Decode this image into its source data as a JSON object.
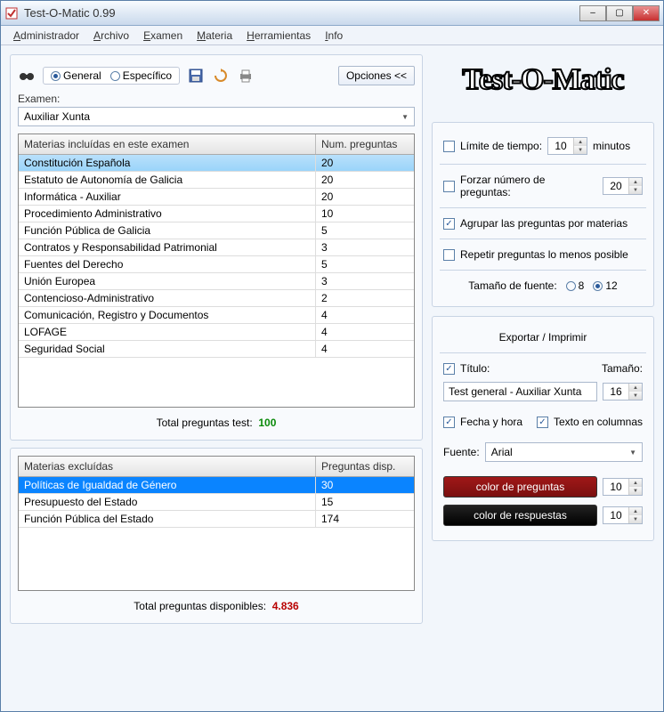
{
  "window": {
    "title": "Test-O-Matic 0.99"
  },
  "menu": [
    "Administrador",
    "Archivo",
    "Examen",
    "Materia",
    "Herramientas",
    "Info"
  ],
  "toolbar": {
    "general": "General",
    "especifico": "Específico",
    "opciones": "Opciones  <<"
  },
  "examen": {
    "label": "Examen:",
    "value": "Auxiliar Xunta"
  },
  "included": {
    "col1": "Materias incluídas en este examen",
    "col2": "Num. preguntas",
    "rows": [
      {
        "name": "Constitución Española",
        "n": "20"
      },
      {
        "name": "Estatuto de Autonomía de Galicia",
        "n": "20"
      },
      {
        "name": "Informática - Auxiliar",
        "n": "20"
      },
      {
        "name": "Procedimiento Administrativo",
        "n": "10"
      },
      {
        "name": "Función Pública de Galicia",
        "n": "5"
      },
      {
        "name": "Contratos y Responsabilidad Patrimonial",
        "n": "3"
      },
      {
        "name": "Fuentes del Derecho",
        "n": "5"
      },
      {
        "name": "Unión Europea",
        "n": "3"
      },
      {
        "name": "Contencioso-Administrativo",
        "n": "2"
      },
      {
        "name": "Comunicación, Registro y Documentos",
        "n": "4"
      },
      {
        "name": "LOFAGE",
        "n": "4"
      },
      {
        "name": "Seguridad Social",
        "n": "4"
      }
    ],
    "total_label": "Total preguntas test:",
    "total_value": "100"
  },
  "excluded": {
    "col1": "Materias excluídas",
    "col2": "Preguntas disp.",
    "rows": [
      {
        "name": "Políticas de Igualdad de Género",
        "n": "30"
      },
      {
        "name": "Presupuesto del Estado",
        "n": "15"
      },
      {
        "name": "Función Pública del Estado",
        "n": "174"
      }
    ],
    "total_label": "Total preguntas disponibles:",
    "total_value": "4.836"
  },
  "logo": "Test-O-Matic",
  "options": {
    "limite": "Límite de tiempo:",
    "limite_val": "10",
    "minutos": "minutos",
    "forzar": "Forzar número de preguntas:",
    "forzar_val": "20",
    "agrupar": "Agrupar las preguntas por materias",
    "repetir": "Repetir preguntas lo menos posible",
    "tamano_fuente": "Tamaño de fuente:",
    "f8": "8",
    "f12": "12",
    "exportar": "Exportar / Imprimir",
    "titulo": "Título:",
    "tamano": "Tamaño:",
    "titulo_val": "Test general - Auxiliar Xunta",
    "titulo_size": "16",
    "fecha": "Fecha y hora",
    "texto_col": "Texto en columnas",
    "fuente": "Fuente:",
    "fuente_val": "Arial",
    "color_preg": "color de preguntas",
    "color_preg_val": "10",
    "color_resp": "color de respuestas",
    "color_resp_val": "10"
  }
}
